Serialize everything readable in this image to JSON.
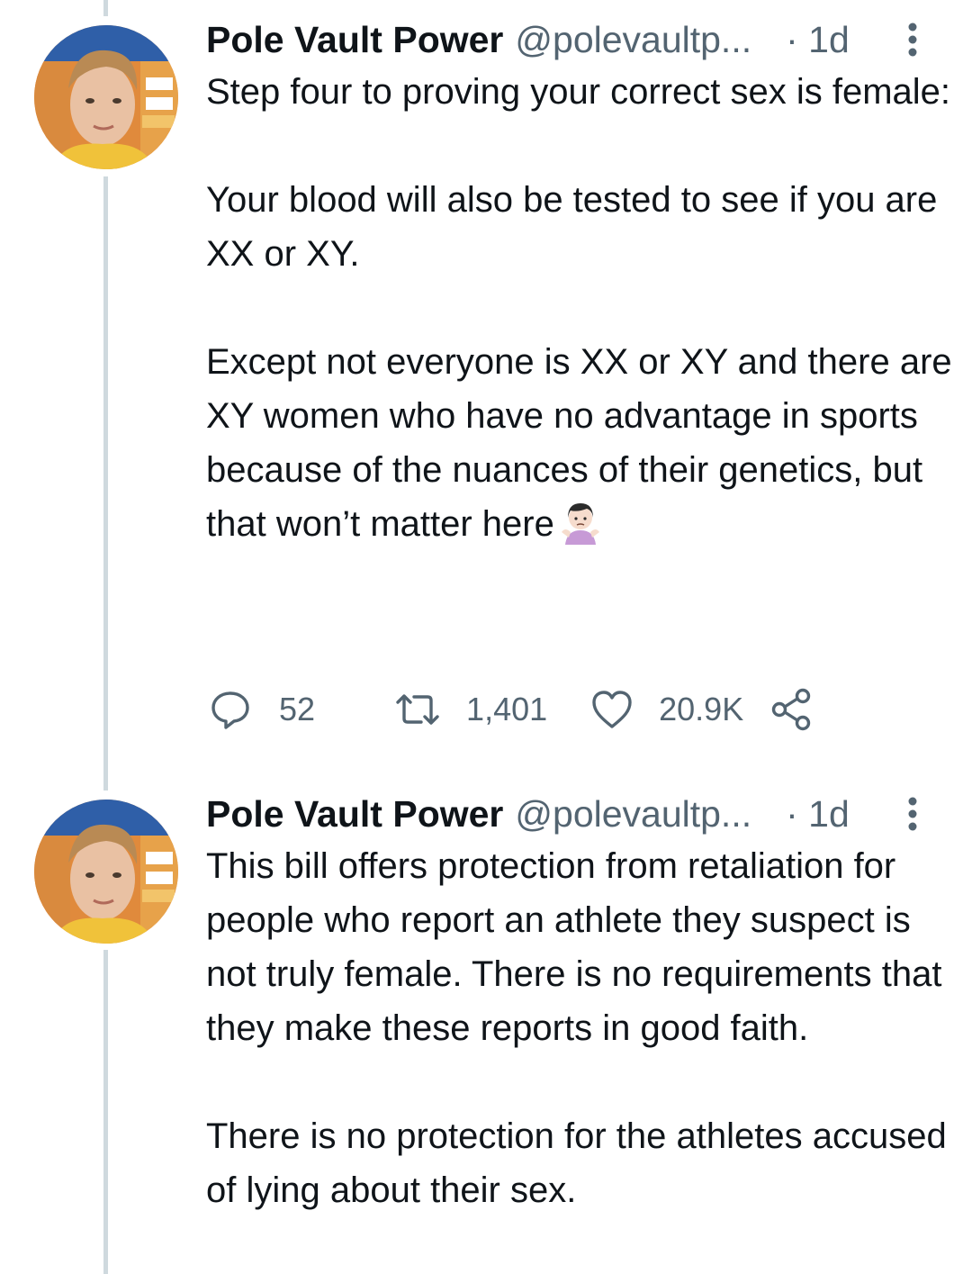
{
  "tweets": [
    {
      "author_name": "Pole Vault Power",
      "handle": "@polevaultp...",
      "time": "· 1d",
      "paragraphs": [
        "Step four to proving your correct sex is female:",
        "Your blood will also be tested to see if you are XX or XY.",
        "Except not everyone is XX or XY and there are XY women who have no advantage in sports because of the nuances of their genetics, but that won’t matter here"
      ],
      "emoji": "person-shrugging-emoji",
      "replies": "52",
      "retweets": "1,401",
      "likes": "20.9K"
    },
    {
      "author_name": "Pole Vault Power",
      "handle": "@polevaultp...",
      "time": "· 1d",
      "paragraphs": [
        "This bill offers protection from retaliation for people who report an athlete they suspect is not truly female. There is no requirements that they make these reports in good faith.",
        "There is no protection for the athletes accused of lying about their sex."
      ]
    }
  ],
  "icons": {
    "reply": "reply-icon",
    "retweet": "retweet-icon",
    "like": "heart-icon",
    "share": "share-icon",
    "more": "more-vertical-icon"
  },
  "colors": {
    "text_primary": "#0f1419",
    "text_secondary": "#536471",
    "thread_line": "#cfd9de"
  }
}
